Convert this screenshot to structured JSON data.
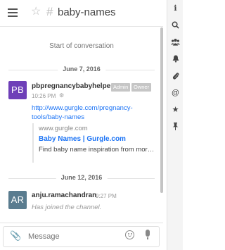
{
  "header": {
    "room_hash": "#",
    "room_name": "baby-names"
  },
  "messages": {
    "start_text": "Start of conversation",
    "date_1": "June 7, 2016",
    "date_2": "June 12, 2016",
    "msg1": {
      "avatar_initials": "PB",
      "avatar_color": "#6e3fb8",
      "author": "pbpregnancybabyhelper",
      "badge_admin": "Admin",
      "badge_owner": "Owner",
      "time": "10:26 PM",
      "link": "http://www.gurgle.com/pregnancy-tools/baby-names",
      "preview_site": "www.gurgle.com",
      "preview_title": "Baby Names | Gurgle.com",
      "preview_desc": "Find baby name inspiration from mor…"
    },
    "msg2": {
      "avatar_initials": "AR",
      "avatar_color": "#5a7c8f",
      "author": "anju.ramachandran",
      "time": "9:27 PM",
      "text": "Has joined the channel."
    }
  },
  "composer": {
    "placeholder": "Message"
  },
  "toolbar": {
    "icons": [
      "info-icon",
      "search-icon",
      "members-icon",
      "bell-icon",
      "attachment-icon",
      "mention-icon",
      "star-icon",
      "pin-icon"
    ]
  }
}
